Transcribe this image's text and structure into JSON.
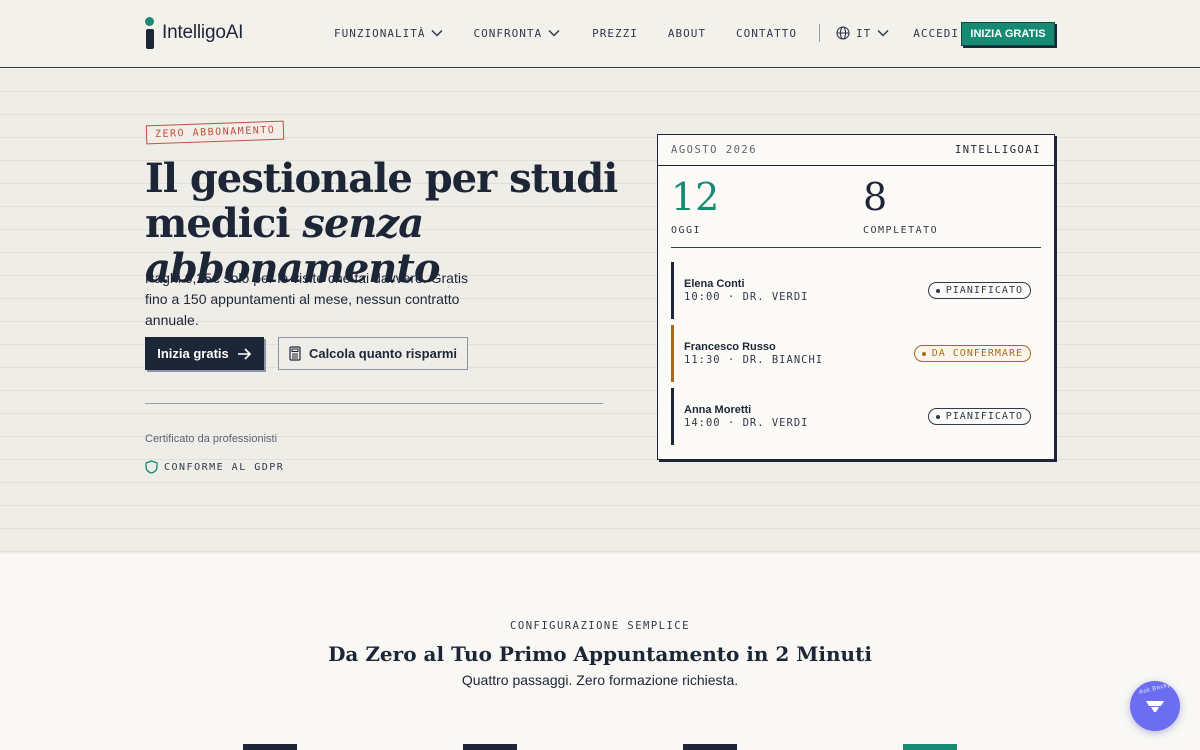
{
  "header": {
    "brand": "IntelligoAI",
    "nav": [
      {
        "label": "FUNZIONALITÀ",
        "dropdown": true
      },
      {
        "label": "CONFRONTA",
        "dropdown": true
      },
      {
        "label": "PREZZI"
      },
      {
        "label": "ABOUT"
      },
      {
        "label": "CONTATTO"
      }
    ],
    "language": "IT",
    "login": "ACCEDI",
    "cta": "INIZIA GRATIS"
  },
  "hero": {
    "badge": "ZERO ABBONAMENTO",
    "title_line1": "Il gestionale per studi",
    "title_line2_plain": "medici ",
    "title_line2_italic": "senza abbonamento",
    "lead": "Paghi 0,25€ solo per le visite che fai davvero. Gratis fino a 150 appuntamenti al mese, nessun contratto annuale.",
    "primary_button": "Inizia gratis",
    "secondary_button": "Calcola quanto risparmi",
    "certified": "Certificato da professionisti",
    "gdpr": "CONFORME AL GDPR"
  },
  "calendar_card": {
    "month": "AGOSTO 2026",
    "brand": "INTELLIGOAI",
    "stats": [
      {
        "value": "12",
        "label": "OGGI",
        "color": "#178a72"
      },
      {
        "value": "8",
        "label": "COMPLETATO",
        "color": "#1c2637"
      }
    ],
    "appointments": [
      {
        "name": "Elena Conti",
        "time": "10:00 · DR. VERDI",
        "status": "PIANIFICATO",
        "accent": "#1c2637",
        "status_color": "#2f3a4b"
      },
      {
        "name": "Francesco Russo",
        "time": "11:30 · DR. BIANCHI",
        "status": "DA CONFERMARE",
        "accent": "#a86a1e",
        "status_color": "#a86a1e"
      },
      {
        "name": "Anna Moretti",
        "time": "14:00 · DR. VERDI",
        "status": "PIANIFICATO",
        "accent": "#1c2637",
        "status_color": "#2f3a4b"
      }
    ]
  },
  "section2": {
    "eyebrow": "CONFIGURAZIONE SEMPLICE",
    "title": "Da Zero al Tuo Primo Appuntamento in 2 Minuti",
    "subtitle": "Quattro passaggi. Zero formazione richiesta."
  },
  "chat_widget": {
    "label": "Ask Becky",
    "icon": "ice-cream-icon"
  },
  "colors": {
    "navy": "#1c2637",
    "teal": "#178a72",
    "rust": "#b8543f",
    "amber": "#a86a1e",
    "chat": "#6b6ef0"
  }
}
